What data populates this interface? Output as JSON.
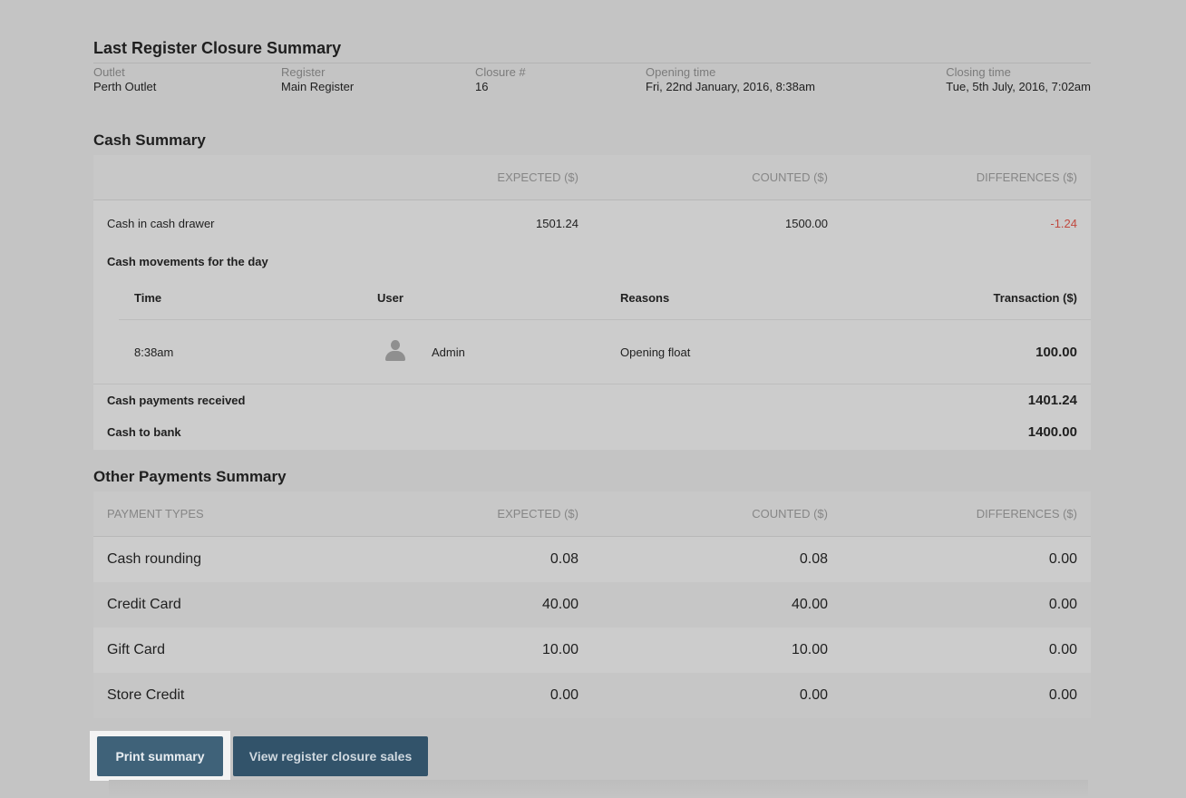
{
  "summary": {
    "title": "Last Register Closure Summary",
    "outlet_label": "Outlet",
    "outlet_value": "Perth Outlet",
    "register_label": "Register",
    "register_value": "Main Register",
    "closure_label": "Closure #",
    "closure_value": "16",
    "opening_label": "Opening time",
    "opening_value": "Fri, 22nd January, 2016, 8:38am",
    "closing_label": "Closing time",
    "closing_value": "Tue, 5th July, 2016, 7:02am"
  },
  "cash": {
    "title": "Cash Summary",
    "headers": {
      "expected": "EXPECTED ($)",
      "counted": "COUNTED ($)",
      "differences": "DIFFERENCES ($)"
    },
    "drawer": {
      "label": "Cash in cash drawer",
      "expected": "1501.24",
      "counted": "1500.00",
      "difference": "-1.24"
    },
    "movements": {
      "title": "Cash movements for the day",
      "headers": {
        "time": "Time",
        "user": "User",
        "reasons": "Reasons",
        "transaction": "Transaction ($)"
      },
      "rows": [
        {
          "time": "8:38am",
          "user": "Admin",
          "reason": "Opening float",
          "transaction": "100.00"
        }
      ]
    },
    "payments_received": {
      "label": "Cash payments received",
      "value": "1401.24"
    },
    "to_bank": {
      "label": "Cash to bank",
      "value": "1400.00"
    }
  },
  "other": {
    "title": "Other Payments Summary",
    "headers": {
      "types": "PAYMENT TYPES",
      "expected": "EXPECTED ($)",
      "counted": "COUNTED ($)",
      "differences": "DIFFERENCES ($)"
    },
    "rows": [
      {
        "type": "Cash rounding",
        "expected": "0.08",
        "counted": "0.08",
        "difference": "0.00"
      },
      {
        "type": "Credit Card",
        "expected": "40.00",
        "counted": "40.00",
        "difference": "0.00"
      },
      {
        "type": "Gift Card",
        "expected": "10.00",
        "counted": "10.00",
        "difference": "0.00"
      },
      {
        "type": "Store Credit",
        "expected": "0.00",
        "counted": "0.00",
        "difference": "0.00"
      }
    ]
  },
  "actions": {
    "print_label": "Print summary",
    "view_sales_label": "View register closure sales"
  },
  "colors": {
    "negative": "#c0493f",
    "primary_button": "#3f6279",
    "secondary_button": "#32536a"
  },
  "icons": {
    "user_avatar": "person-icon"
  }
}
